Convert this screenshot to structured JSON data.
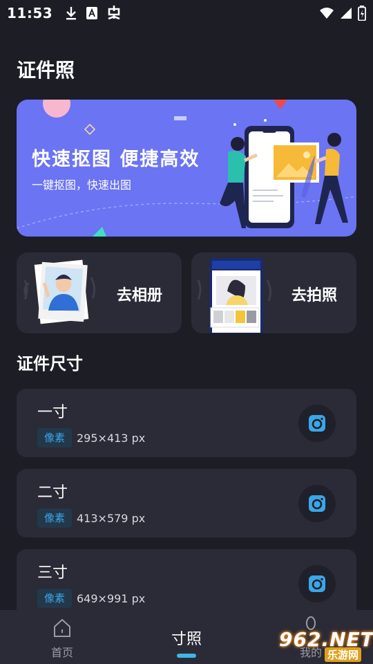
{
  "status_bar": {
    "time": "11:53",
    "left_icons": [
      "download-icon",
      "font-a-icon",
      "app-icon"
    ],
    "right_icons": [
      "wifi-icon",
      "signal-icon",
      "battery-icon"
    ]
  },
  "page": {
    "title": "证件照"
  },
  "banner": {
    "title": "快速抠图 便捷高效",
    "subtitle": "一键抠图，快速出图",
    "background_color": "#6b74f2"
  },
  "actions": [
    {
      "label": "去相册",
      "icon": "album-photo-icon"
    },
    {
      "label": "去拍照",
      "icon": "phone-camera-icon"
    }
  ],
  "section": {
    "title": "证件尺寸"
  },
  "sizes": [
    {
      "name": "一寸",
      "badge": "像素",
      "dimensions": "295×413 px",
      "icon": "camera-icon"
    },
    {
      "name": "二寸",
      "badge": "像素",
      "dimensions": "413×579 px",
      "icon": "camera-icon"
    },
    {
      "name": "三寸",
      "badge": "像素",
      "dimensions": "649×991 px",
      "icon": "camera-icon"
    }
  ],
  "bottom_nav": {
    "items": [
      {
        "label": "首页",
        "icon": "home-icon",
        "active": false
      },
      {
        "label": "寸照",
        "icon": "",
        "active": true
      },
      {
        "label": "我的",
        "icon": "user-icon",
        "active": false
      }
    ],
    "active_color": "#3fb5e8"
  },
  "watermark": {
    "top": "962.NET",
    "bottom": "乐游网"
  },
  "colors": {
    "background": "#1c1d25",
    "card": "#2a2b36",
    "accent": "#3aa6e8"
  }
}
